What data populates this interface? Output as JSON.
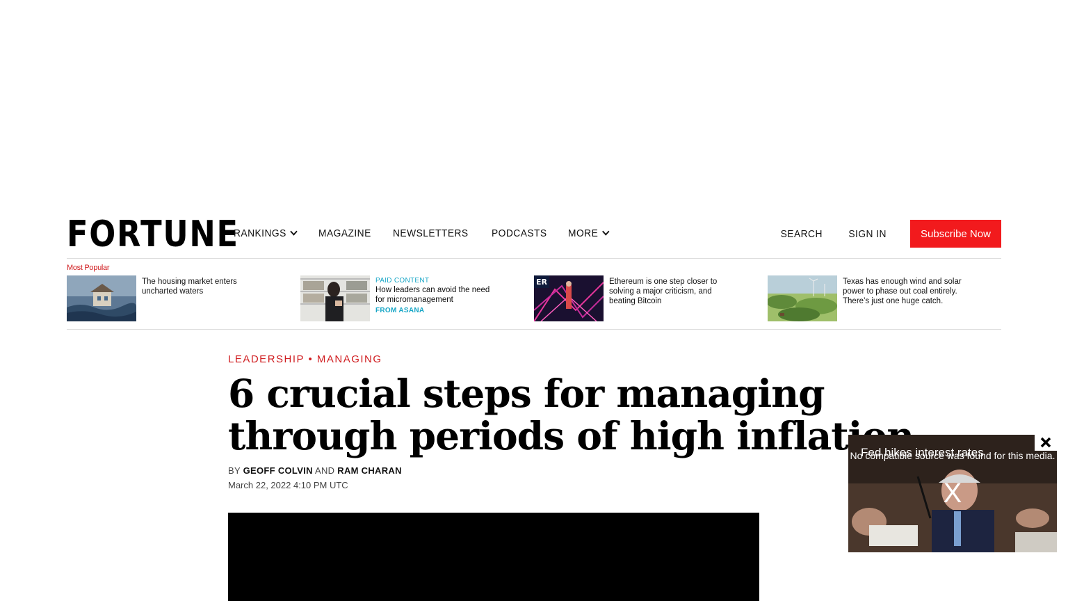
{
  "header": {
    "logo": "FORTUNE",
    "nav": [
      "RANKINGS",
      "MAGAZINE",
      "NEWSLETTERS",
      "PODCASTS",
      "MORE"
    ],
    "search": "SEARCH",
    "sign_in": "SIGN IN",
    "subscribe": "Subscribe Now"
  },
  "popular": {
    "label": "Most Popular",
    "items": [
      {
        "title": "The housing market enters uncharted waters"
      },
      {
        "paid": "PAID CONTENT",
        "title": "How leaders can avoid the need for micromanagement",
        "from": "FROM ASANA"
      },
      {
        "title": "Ethereum is one step closer to solving a major criticism, and beating Bitcoin"
      },
      {
        "title": "Texas has enough wind and solar power to phase out coal entirely. There’s just one huge catch."
      }
    ]
  },
  "article": {
    "kicker": [
      "LEADERSHIP",
      "MANAGING"
    ],
    "title": "6 crucial steps for managing through periods of high inflation",
    "by": "BY",
    "authors": [
      "GEOFF COLVIN",
      "RAM CHARAN"
    ],
    "and": "AND",
    "date": "March 22, 2022 4:10 PM UTC"
  },
  "floating_video": {
    "title": "Fed hikes interest rates",
    "error": "No compatible source was found for this media.",
    "x": "X"
  },
  "colors": {
    "accent_red": "#d01c1f",
    "subscribe_bg": "#f21a1d",
    "paid_cyan": "#17a6c6"
  }
}
